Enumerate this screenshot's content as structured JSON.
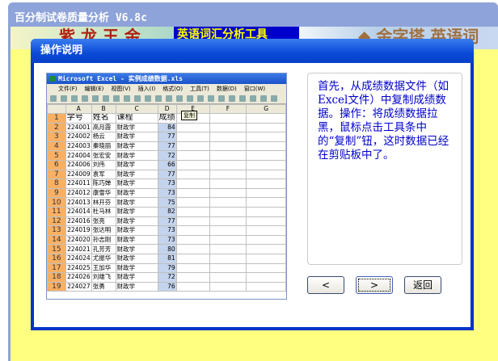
{
  "window": {
    "title": "百分制试卷质量分析  V6.8c"
  },
  "banner": {
    "text": "英语词汇分析工具",
    "deco_left": "紫  龙  王  金",
    "deco_right": "◆ 金字塔 英语词"
  },
  "dialog": {
    "title": "操作说明",
    "instruction": "首先，从成绩数据文件（如Excel文件）中复制成绩数据。操作：将成绩数据拉黑，鼠标点击工具条中的“复制”钮，这时数据已经在剪贴板中了。",
    "buttons": {
      "prev": "<",
      "next": ">",
      "back": "返回"
    }
  },
  "excel": {
    "title": "Microsoft Excel - 实例成绩数据.xls",
    "menu": [
      "文件(F)",
      "编辑(E)",
      "视图(V)",
      "插入(I)",
      "格式(O)",
      "工具(T)",
      "数据(D)",
      "窗口(W)"
    ],
    "tooltip": "复制",
    "columns": [
      "A",
      "B",
      "C",
      "D",
      "E",
      "F",
      "G"
    ],
    "header": [
      "学号",
      "姓名",
      "课程",
      "成绩"
    ],
    "rows": [
      [
        "224001",
        "高月霞",
        "财政学",
        "84"
      ],
      [
        "224002",
        "杨云",
        "财政学",
        "77"
      ],
      [
        "224003",
        "秦晓丽",
        "财政学",
        "77"
      ],
      [
        "224004",
        "张宏安",
        "财政学",
        "72"
      ],
      [
        "224006",
        "刘伟",
        "财政学",
        "66"
      ],
      [
        "224009",
        "袁军",
        "财政学",
        "77"
      ],
      [
        "224011",
        "陈巧婵",
        "财政学",
        "73"
      ],
      [
        "224012",
        "康雪华",
        "财政学",
        "73"
      ],
      [
        "224013",
        "林开芬",
        "财政学",
        "75"
      ],
      [
        "224014",
        "杜马林",
        "财政学",
        "82"
      ],
      [
        "224016",
        "张亮",
        "财政学",
        "77"
      ],
      [
        "224019",
        "张达明",
        "财政学",
        "73"
      ],
      [
        "224020",
        "孙志刚",
        "财政学",
        "73"
      ],
      [
        "224021",
        "孔芳芳",
        "财政学",
        "80"
      ],
      [
        "224024",
        "尤振华",
        "财政学",
        "81"
      ],
      [
        "224025",
        "王加华",
        "财政学",
        "79"
      ],
      [
        "224026",
        "刘雄飞",
        "财政学",
        "72"
      ],
      [
        "224027",
        "张勇",
        "财政学",
        "76"
      ]
    ]
  }
}
